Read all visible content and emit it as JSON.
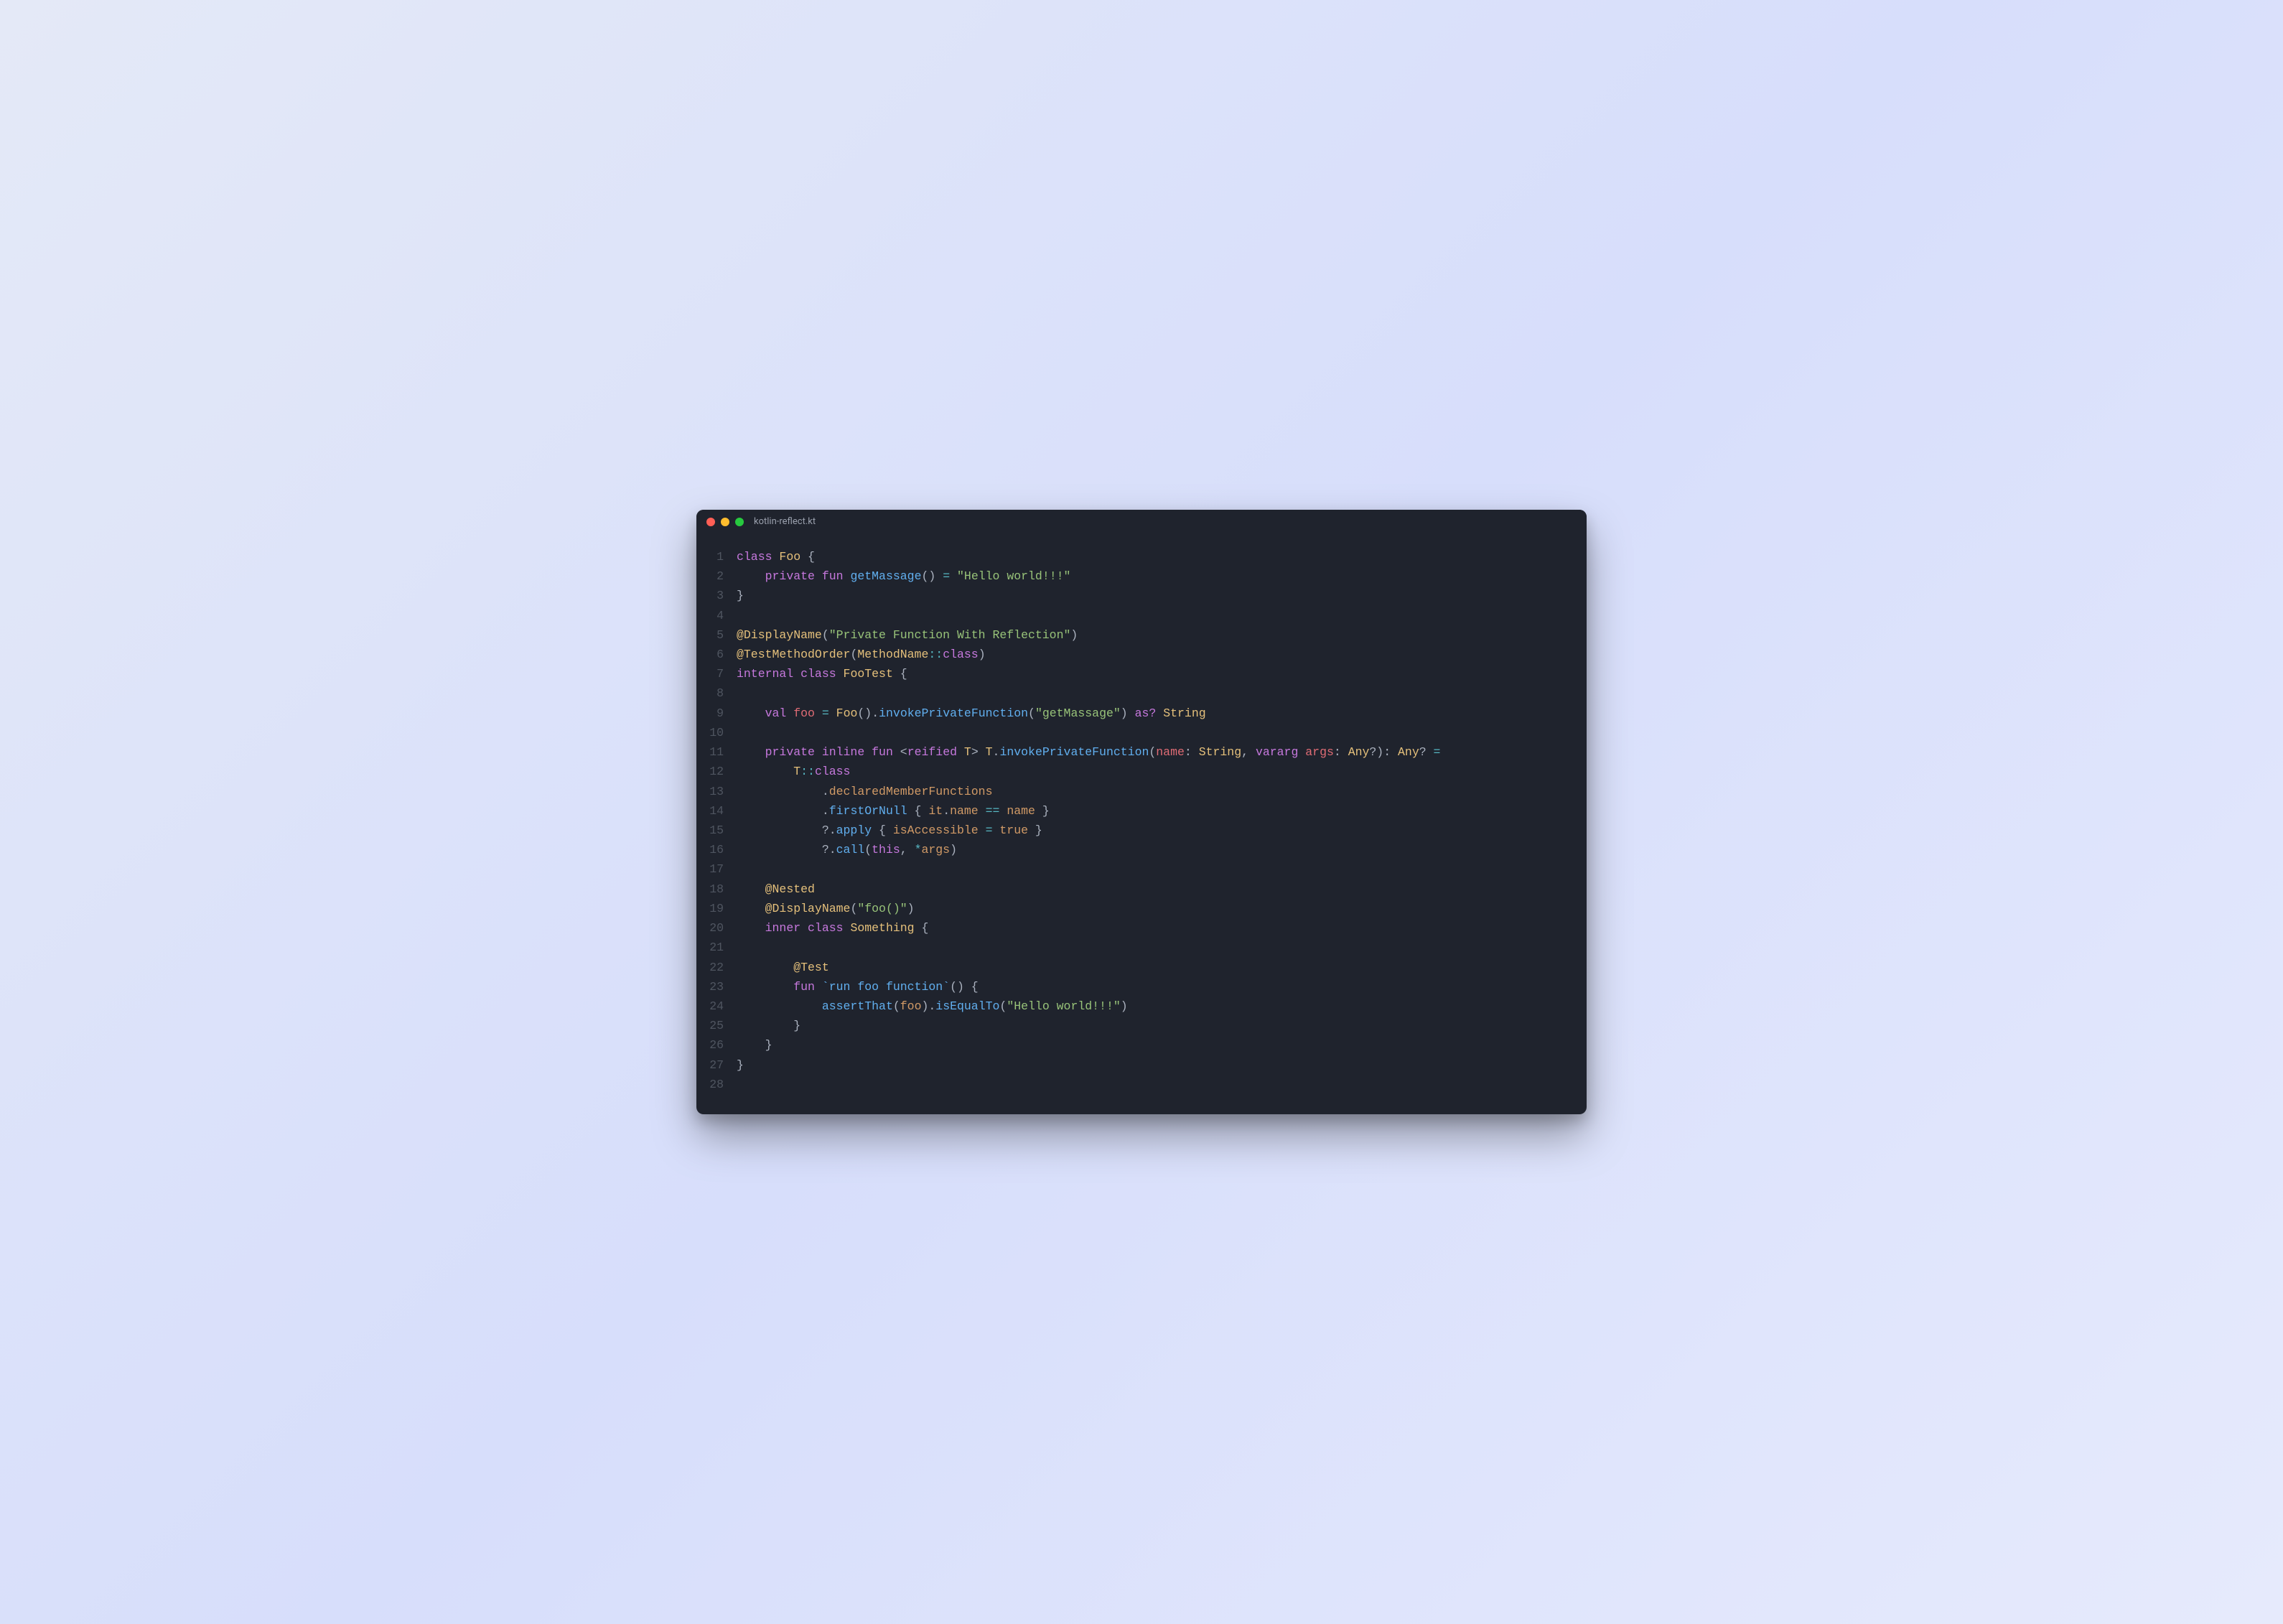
{
  "window": {
    "title": "kotlin-reflect.kt",
    "traffic": {
      "red": "#ff5f56",
      "yellow": "#ffbd2e",
      "green": "#27c93f"
    }
  },
  "editor": {
    "lineStart": 1,
    "lineEnd": 28,
    "lines": [
      [
        [
          "kw",
          "class"
        ],
        [
          "pn",
          " "
        ],
        [
          "ty",
          "Foo"
        ],
        [
          "pn",
          " {"
        ]
      ],
      [
        [
          "pn",
          "    "
        ],
        [
          "kw",
          "private"
        ],
        [
          "pn",
          " "
        ],
        [
          "kw",
          "fun"
        ],
        [
          "pn",
          " "
        ],
        [
          "fn",
          "getMassage"
        ],
        [
          "pn",
          "() "
        ],
        [
          "op",
          "="
        ],
        [
          "pn",
          " "
        ],
        [
          "str",
          "\"Hello world!!!\""
        ]
      ],
      [
        [
          "pn",
          "}"
        ]
      ],
      [],
      [
        [
          "ann",
          "@DisplayName"
        ],
        [
          "pn",
          "("
        ],
        [
          "str",
          "\"Private Function With Reflection\""
        ],
        [
          "pn",
          ")"
        ]
      ],
      [
        [
          "ann",
          "@TestMethodOrder"
        ],
        [
          "pn",
          "("
        ],
        [
          "ty",
          "MethodName"
        ],
        [
          "op",
          "::"
        ],
        [
          "kw",
          "class"
        ],
        [
          "pn",
          ")"
        ]
      ],
      [
        [
          "kw",
          "internal"
        ],
        [
          "pn",
          " "
        ],
        [
          "kw",
          "class"
        ],
        [
          "pn",
          " "
        ],
        [
          "ty",
          "FooTest"
        ],
        [
          "pn",
          " {"
        ]
      ],
      [],
      [
        [
          "pn",
          "    "
        ],
        [
          "kw",
          "val"
        ],
        [
          "pn",
          " "
        ],
        [
          "nm",
          "foo"
        ],
        [
          "pn",
          " "
        ],
        [
          "op",
          "="
        ],
        [
          "pn",
          " "
        ],
        [
          "ty",
          "Foo"
        ],
        [
          "pn",
          "()."
        ],
        [
          "fn",
          "invokePrivateFunction"
        ],
        [
          "pn",
          "("
        ],
        [
          "str",
          "\"getMassage\""
        ],
        [
          "pn",
          ") "
        ],
        [
          "kw",
          "as?"
        ],
        [
          "pn",
          " "
        ],
        [
          "ty",
          "String"
        ]
      ],
      [],
      [
        [
          "pn",
          "    "
        ],
        [
          "kw",
          "private"
        ],
        [
          "pn",
          " "
        ],
        [
          "kw",
          "inline"
        ],
        [
          "pn",
          " "
        ],
        [
          "kw",
          "fun"
        ],
        [
          "pn",
          " <"
        ],
        [
          "kw",
          "reified"
        ],
        [
          "pn",
          " "
        ],
        [
          "ty",
          "T"
        ],
        [
          "pn",
          "> "
        ],
        [
          "ty",
          "T"
        ],
        [
          "pn",
          "."
        ],
        [
          "fn",
          "invokePrivateFunction"
        ],
        [
          "pn",
          "("
        ],
        [
          "nm",
          "name"
        ],
        [
          "pn",
          ": "
        ],
        [
          "ty",
          "String"
        ],
        [
          "pn",
          ", "
        ],
        [
          "kw",
          "vararg"
        ],
        [
          "pn",
          " "
        ],
        [
          "nm",
          "args"
        ],
        [
          "pn",
          ": "
        ],
        [
          "ty",
          "Any"
        ],
        [
          "pn",
          "?): "
        ],
        [
          "ty",
          "Any"
        ],
        [
          "pn",
          "? "
        ],
        [
          "op",
          "="
        ]
      ],
      [
        [
          "pn",
          "        "
        ],
        [
          "ty",
          "T"
        ],
        [
          "op",
          "::"
        ],
        [
          "kw",
          "class"
        ]
      ],
      [
        [
          "pn",
          "            ."
        ],
        [
          "pr",
          "declaredMemberFunctions"
        ]
      ],
      [
        [
          "pn",
          "            ."
        ],
        [
          "fn",
          "firstOrNull"
        ],
        [
          "pn",
          " { "
        ],
        [
          "pr",
          "it"
        ],
        [
          "pn",
          "."
        ],
        [
          "pr",
          "name"
        ],
        [
          "pn",
          " "
        ],
        [
          "op",
          "=="
        ],
        [
          "pn",
          " "
        ],
        [
          "pr",
          "name"
        ],
        [
          "pn",
          " }"
        ]
      ],
      [
        [
          "pn",
          "            ?."
        ],
        [
          "fn",
          "apply"
        ],
        [
          "pn",
          " { "
        ],
        [
          "pr",
          "isAccessible"
        ],
        [
          "pn",
          " "
        ],
        [
          "op",
          "="
        ],
        [
          "pn",
          " "
        ],
        [
          "pr",
          "true"
        ],
        [
          "pn",
          " }"
        ]
      ],
      [
        [
          "pn",
          "            ?."
        ],
        [
          "fn",
          "call"
        ],
        [
          "pn",
          "("
        ],
        [
          "kw",
          "this"
        ],
        [
          "pn",
          ", "
        ],
        [
          "op",
          "*"
        ],
        [
          "pr",
          "args"
        ],
        [
          "pn",
          ")"
        ]
      ],
      [],
      [
        [
          "pn",
          "    "
        ],
        [
          "ann",
          "@Nested"
        ]
      ],
      [
        [
          "pn",
          "    "
        ],
        [
          "ann",
          "@DisplayName"
        ],
        [
          "pn",
          "("
        ],
        [
          "str",
          "\"foo()\""
        ],
        [
          "pn",
          ")"
        ]
      ],
      [
        [
          "pn",
          "    "
        ],
        [
          "kw",
          "inner"
        ],
        [
          "pn",
          " "
        ],
        [
          "kw",
          "class"
        ],
        [
          "pn",
          " "
        ],
        [
          "ty",
          "Something"
        ],
        [
          "pn",
          " {"
        ]
      ],
      [],
      [
        [
          "pn",
          "        "
        ],
        [
          "ann",
          "@Test"
        ]
      ],
      [
        [
          "pn",
          "        "
        ],
        [
          "kw",
          "fun"
        ],
        [
          "pn",
          " "
        ],
        [
          "fn",
          "`run foo function`"
        ],
        [
          "pn",
          "() {"
        ]
      ],
      [
        [
          "pn",
          "            "
        ],
        [
          "fn",
          "assertThat"
        ],
        [
          "pn",
          "("
        ],
        [
          "pr",
          "foo"
        ],
        [
          "pn",
          ")."
        ],
        [
          "fn",
          "isEqualTo"
        ],
        [
          "pn",
          "("
        ],
        [
          "str",
          "\"Hello world!!!\""
        ],
        [
          "pn",
          ")"
        ]
      ],
      [
        [
          "pn",
          "        }"
        ]
      ],
      [
        [
          "pn",
          "    }"
        ]
      ],
      [
        [
          "pn",
          "}"
        ]
      ],
      []
    ]
  }
}
